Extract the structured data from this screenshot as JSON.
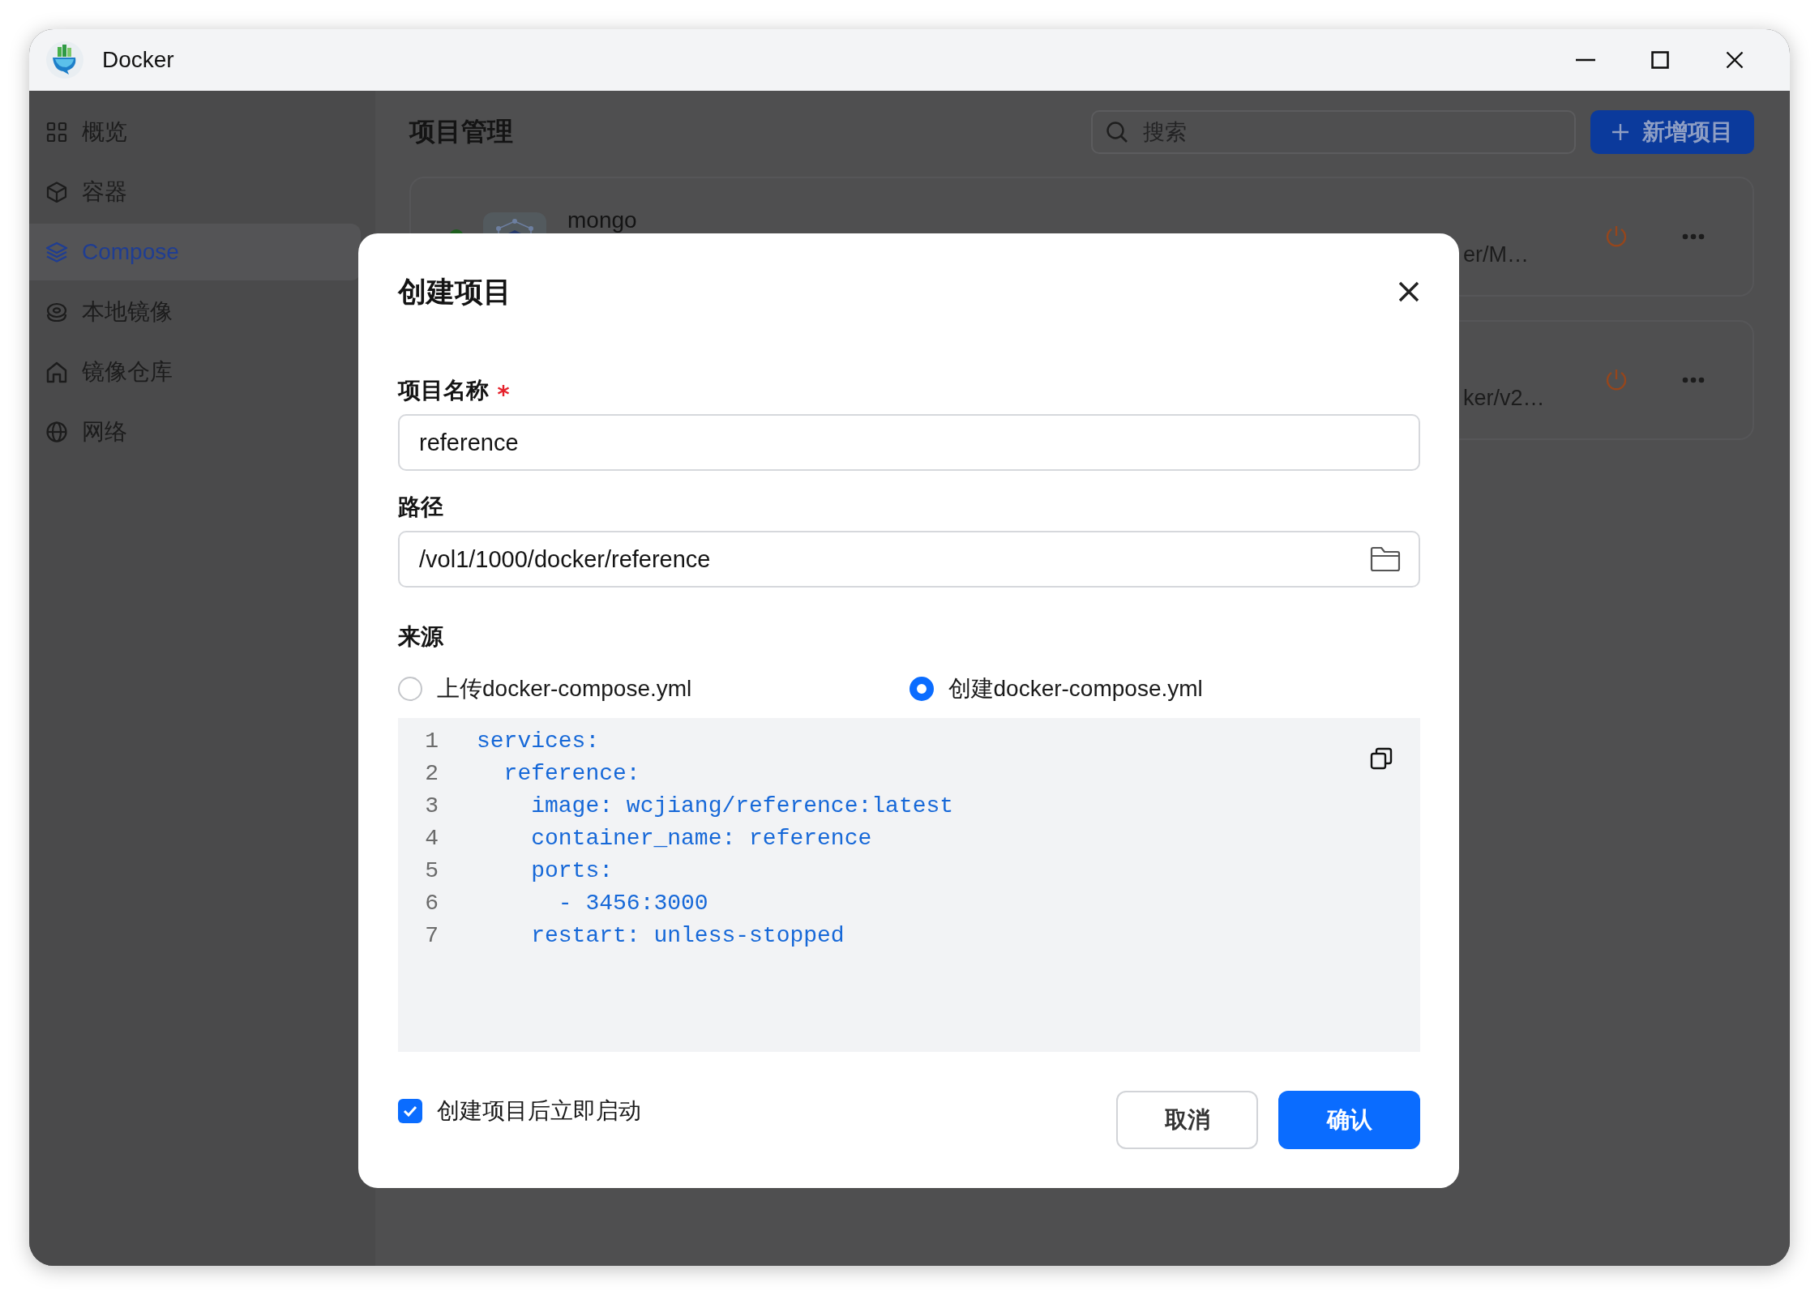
{
  "window": {
    "title": "Docker"
  },
  "sidebar": {
    "items": [
      {
        "label": "概览",
        "selected": false
      },
      {
        "label": "容器",
        "selected": false
      },
      {
        "label": "Compose",
        "selected": true
      },
      {
        "label": "本地镜像",
        "selected": false
      },
      {
        "label": "镜像仓库",
        "selected": false
      },
      {
        "label": "网络",
        "selected": false
      }
    ]
  },
  "main": {
    "title": "项目管理",
    "search": {
      "placeholder": "搜索"
    },
    "add_button": {
      "label": "新增项目"
    },
    "projects": [
      {
        "name": "mongo",
        "path": "er/M…",
        "running": true
      },
      {
        "path": "ker/v2…"
      }
    ]
  },
  "dialog": {
    "title": "创建项目",
    "fields": [
      {
        "label": "项目名称",
        "required": true,
        "value": "reference",
        "kind": "text"
      },
      {
        "label": "路径",
        "required": false,
        "value": "/vol1/1000/docker/reference",
        "kind": "folder"
      }
    ],
    "source": {
      "label": "来源",
      "options": [
        {
          "label": "上传docker-compose.yml",
          "selected": false
        },
        {
          "label": "创建docker-compose.yml",
          "selected": true
        }
      ],
      "code_lines": [
        {
          "number": "1",
          "text": "services:"
        },
        {
          "number": "2",
          "text": "  reference:"
        },
        {
          "number": "3",
          "text": "    image: wcjiang/reference:latest"
        },
        {
          "number": "4",
          "text": "    container_name: reference"
        },
        {
          "number": "5",
          "text": "    ports:"
        },
        {
          "number": "6",
          "text": "      - 3456:3000"
        },
        {
          "number": "7",
          "text": "    restart: unless-stopped"
        }
      ]
    },
    "auto_start": {
      "label": "创建项目后立即启动",
      "checked": true
    },
    "buttons": [
      {
        "label": "取消",
        "kind": "secondary"
      },
      {
        "label": "确认",
        "kind": "primary"
      }
    ]
  }
}
